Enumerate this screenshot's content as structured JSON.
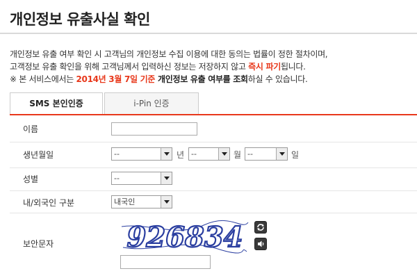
{
  "page": {
    "title": "개인정보 유출사실 확인"
  },
  "description": {
    "line1": "개인정보 유출 여부 확인 시 고객님의 개인정보 수집 이용에 대한 동의는 법률이 정한 절차이며,",
    "line2_before": "고객정보 유출 확인을 위해 고객님께서 입력하신 정보는 저장하지 않고 ",
    "line2_emph": "즉시 파기",
    "line2_after": "됩니다.",
    "line3_prefix": "※ 본 서비스에서는 ",
    "line3_date": "2014년 3월 7일 기준",
    "line3_mid1": " 개인정보 유출 여부를 ",
    "line3_bold": "조회",
    "line3_after": "하실 수 있습니다."
  },
  "tabs": [
    {
      "label": "SMS 본인인증",
      "active": true
    },
    {
      "label": "i-Pin 인증",
      "active": false
    }
  ],
  "form": {
    "name": {
      "label": "이름",
      "value": ""
    },
    "birth": {
      "label": "생년월일",
      "year": "--",
      "year_unit": "년",
      "month": "--",
      "month_unit": "월",
      "day": "--",
      "day_unit": "일"
    },
    "gender": {
      "label": "성별",
      "value": "--"
    },
    "nationality": {
      "label": "내/외국인 구분",
      "value": "내국인"
    },
    "captcha": {
      "label": "보안문자",
      "code": "926834",
      "refresh_icon": "refresh-icon",
      "audio_icon": "speaker-icon",
      "input_value": ""
    }
  },
  "colors": {
    "accent": "#e8381b",
    "captcha_text": "#2a3ea0"
  }
}
